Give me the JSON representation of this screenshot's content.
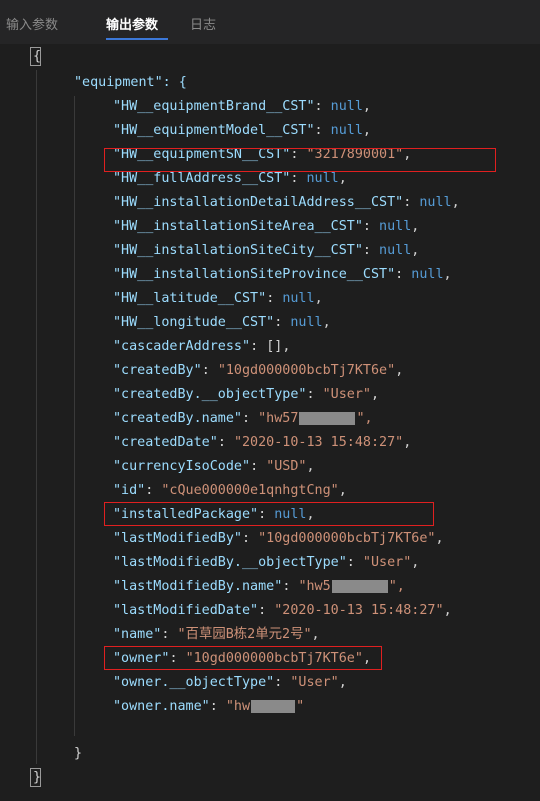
{
  "tabs": [
    {
      "label": "输入参数"
    },
    {
      "label": "输出参数"
    },
    {
      "label": "日志"
    }
  ],
  "code": {
    "open_brace": "{",
    "close_brace": "}",
    "equipment_open": "\"equipment\": {",
    "equipment_close": "}",
    "lines": [
      {
        "key": "\"HW__equipmentBrand__CST\"",
        "sep": ": ",
        "value": "null",
        "vtype": "n",
        "tail": ","
      },
      {
        "key": "\"HW__equipmentModel__CST\"",
        "sep": ": ",
        "value": "null",
        "vtype": "n",
        "tail": ","
      },
      {
        "key": "\"HW__equipmentSN__CST\"",
        "sep": ": ",
        "value": "\"3217890001\"",
        "vtype": "s",
        "tail": ","
      },
      {
        "key": "\"HW__fullAddress__CST\"",
        "sep": ": ",
        "value": "null",
        "vtype": "n",
        "tail": ","
      },
      {
        "key": "\"HW__installationDetailAddress__CST\"",
        "sep": ": ",
        "value": "null",
        "vtype": "n",
        "tail": ","
      },
      {
        "key": "\"HW__installationSiteArea__CST\"",
        "sep": ": ",
        "value": "null",
        "vtype": "n",
        "tail": ","
      },
      {
        "key": "\"HW__installationSiteCity__CST\"",
        "sep": ": ",
        "value": "null",
        "vtype": "n",
        "tail": ","
      },
      {
        "key": "\"HW__installationSiteProvince__CST\"",
        "sep": ": ",
        "value": "null",
        "vtype": "n",
        "tail": ","
      },
      {
        "key": "\"HW__latitude__CST\"",
        "sep": ": ",
        "value": "null",
        "vtype": "n",
        "tail": ","
      },
      {
        "key": "\"HW__longitude__CST\"",
        "sep": ": ",
        "value": "null",
        "vtype": "n",
        "tail": ","
      },
      {
        "key": "\"cascaderAddress\"",
        "sep": ": ",
        "value": "[]",
        "vtype": "p",
        "tail": ","
      },
      {
        "key": "\"createdBy\"",
        "sep": ": ",
        "value": "\"10gd000000bcbTj7KT6e\"",
        "vtype": "s",
        "tail": ","
      },
      {
        "key": "\"createdBy.__objectType\"",
        "sep": ": ",
        "value": "\"User\"",
        "vtype": "s",
        "tail": ","
      },
      {
        "key": "\"createdBy.name\"",
        "sep": ": ",
        "value": "\"hw57",
        "vtype": "s",
        "tail": "\",",
        "masked": true
      },
      {
        "key": "\"createdDate\"",
        "sep": ": ",
        "value": "\"2020-10-13 15:48:27\"",
        "vtype": "s",
        "tail": ","
      },
      {
        "key": "\"currencyIsoCode\"",
        "sep": ": ",
        "value": "\"USD\"",
        "vtype": "s",
        "tail": ","
      },
      {
        "key": "\"id\"",
        "sep": ": ",
        "value": "\"cQue000000e1qnhgtCng\"",
        "vtype": "s",
        "tail": ","
      },
      {
        "key": "\"installedPackage\"",
        "sep": ": ",
        "value": "null",
        "vtype": "n",
        "tail": ","
      },
      {
        "key": "\"lastModifiedBy\"",
        "sep": ": ",
        "value": "\"10gd000000bcbTj7KT6e\"",
        "vtype": "s",
        "tail": ","
      },
      {
        "key": "\"lastModifiedBy.__objectType\"",
        "sep": ": ",
        "value": "\"User\"",
        "vtype": "s",
        "tail": ","
      },
      {
        "key": "\"lastModifiedBy.name\"",
        "sep": ": ",
        "value": "\"hw5",
        "vtype": "s",
        "tail": "\",",
        "masked": true
      },
      {
        "key": "\"lastModifiedDate\"",
        "sep": ": ",
        "value": "\"2020-10-13 15:48:27\"",
        "vtype": "s",
        "tail": ","
      },
      {
        "key": "\"name\"",
        "sep": ": ",
        "value": "\"百草园B栋2单元2号\"",
        "vtype": "s",
        "tail": ","
      },
      {
        "key": "\"owner\"",
        "sep": ": ",
        "value": "\"10gd000000bcbTj7KT6e\"",
        "vtype": "s",
        "tail": ","
      },
      {
        "key": "\"owner.__objectType\"",
        "sep": ": ",
        "value": "\"User\"",
        "vtype": "s",
        "tail": ","
      },
      {
        "key": "\"owner.name\"",
        "sep": ": ",
        "value": "\"hw",
        "vtype": "s",
        "tail": "\"",
        "masked": true
      }
    ]
  },
  "colors": {
    "key": "#9cdcfe",
    "string": "#ce9178",
    "keyword": "#569cd6",
    "highlight_box": "#e02020",
    "active_tab_underline": "#3c78d8"
  }
}
